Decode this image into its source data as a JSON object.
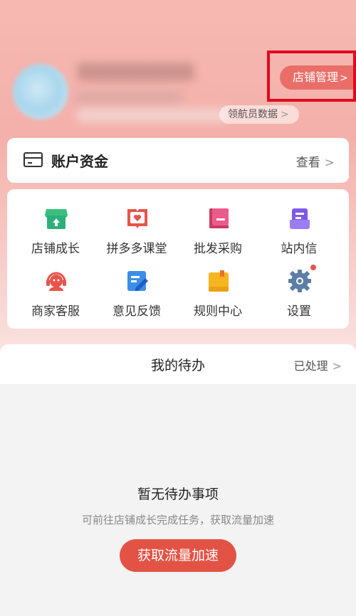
{
  "header": {
    "shop_manage_label": "店铺管理",
    "shop_manage_chevron": ">",
    "nav_data_label": "领航员数据",
    "nav_data_chevron": ">"
  },
  "account": {
    "title": "账户资金",
    "view_label": "查看",
    "view_chevron": ">"
  },
  "grid": {
    "items": [
      {
        "label": "店铺成长",
        "icon": "shop-growth-icon"
      },
      {
        "label": "拼多多课堂",
        "icon": "class-book-icon"
      },
      {
        "label": "批发采购",
        "icon": "wholesale-book-icon"
      },
      {
        "label": "站内信",
        "icon": "inbox-message-icon"
      },
      {
        "label": "商家客服",
        "icon": "headset-service-icon"
      },
      {
        "label": "意见反馈",
        "icon": "feedback-edit-icon"
      },
      {
        "label": "规则中心",
        "icon": "rules-folder-icon"
      },
      {
        "label": "设置",
        "icon": "settings-gear-icon"
      }
    ]
  },
  "todo": {
    "title": "我的待办",
    "processed_label": "已处理",
    "processed_chevron": ">",
    "empty_title": "暂无待办事项",
    "empty_desc": "可前往店铺成长完成任务，获取流量加速",
    "boost_button_label": "获取流量加速"
  },
  "colors": {
    "accent": "#e35345",
    "highlight_box": "#e0091d",
    "shop_manage_bg": "#ea6e68"
  }
}
